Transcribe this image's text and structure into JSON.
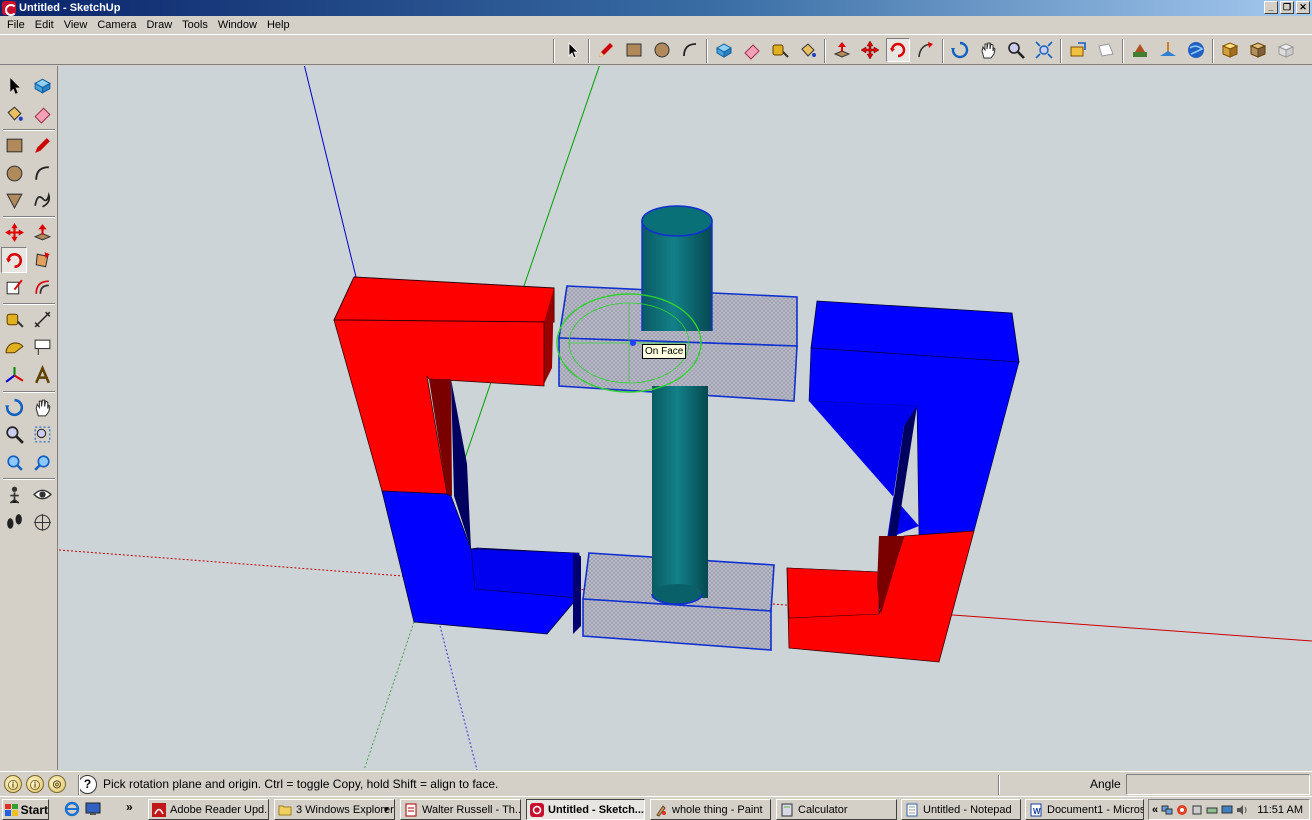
{
  "window": {
    "title": "Untitled - SketchUp"
  },
  "menu": [
    "File",
    "Edit",
    "View",
    "Camera",
    "Draw",
    "Tools",
    "Window",
    "Help"
  ],
  "top_toolbar": {
    "tools": [
      "select-icon",
      "pencil-icon",
      "rectangle-icon",
      "circle-icon",
      "arc-icon",
      "make-component-icon",
      "eraser-icon",
      "tape-measure-icon",
      "paint-bucket-icon",
      "push-pull-icon",
      "move-icon",
      "rotate-icon",
      "follow-me-icon",
      "orbit-icon",
      "pan-icon",
      "zoom-icon",
      "zoom-extents-icon",
      "previous-view-icon",
      "next-view-icon",
      "get-models-icon",
      "share-model-icon",
      "google-earth-icon",
      "get-current-view-icon",
      "toggle-terrain-icon",
      "place-model-icon"
    ],
    "active": "rotate-icon"
  },
  "left_toolbar": {
    "tools": [
      "select-icon",
      "make-component-icon",
      "paint-bucket-icon",
      "eraser-icon",
      "rectangle-icon",
      "line-icon",
      "circle-icon",
      "arc-icon",
      "polygon-icon",
      "freehand-icon",
      "move-icon",
      "push-pull-icon",
      "rotate-icon",
      "follow-me-icon",
      "scale-icon",
      "offset-icon",
      "tape-measure-icon",
      "dimension-icon",
      "protractor-icon",
      "text-icon",
      "axes-icon",
      "3d-text-icon",
      "orbit-icon",
      "pan-icon",
      "zoom-icon",
      "zoom-window-icon",
      "zoom-extents-icon",
      "previous-icon",
      "position-camera-icon",
      "look-around-icon",
      "walk-icon",
      "section-plane-icon"
    ],
    "active": "rotate-icon"
  },
  "viewport": {
    "tooltip": "On Face",
    "colors": {
      "background": "#ccd4d8",
      "red": "#ff0000",
      "blue": "#0000ff",
      "teal": "#006c74",
      "gray_face": "#b4b6c4"
    }
  },
  "status": {
    "hint": "Pick rotation plane and origin.  Ctrl = toggle Copy, hold Shift = align to face.",
    "vcb_label": "Angle",
    "vcb_value": ""
  },
  "taskbar": {
    "start": "Start",
    "overflow": "»",
    "tasks": [
      {
        "label": "Adobe Reader Upd...",
        "icon": "adobe-reader-icon",
        "active": false
      },
      {
        "label": "3 Windows Explorer",
        "icon": "folder-icon",
        "active": false,
        "group": true
      },
      {
        "label": "Walter Russell - Th...",
        "icon": "pdf-document-icon",
        "active": false
      },
      {
        "label": "Untitled - Sketch...",
        "icon": "sketchup-icon",
        "active": true
      },
      {
        "label": "whole thing - Paint",
        "icon": "paint-icon",
        "active": false
      },
      {
        "label": "Calculator",
        "icon": "calculator-icon",
        "active": false
      },
      {
        "label": "Untitled - Notepad",
        "icon": "notepad-icon",
        "active": false
      },
      {
        "label": "Document1 - Micros...",
        "icon": "word-icon",
        "active": false
      }
    ],
    "tray_expand": "«",
    "clock": "11:51 AM"
  }
}
